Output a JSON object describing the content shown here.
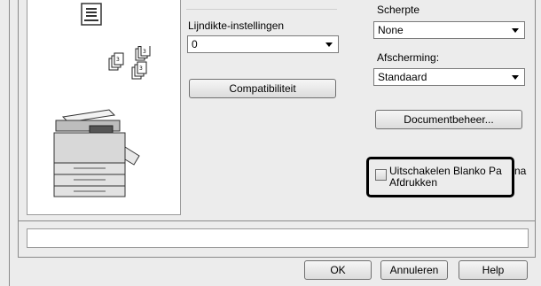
{
  "paper_thickness": {
    "label": "Lijndikte-instellingen",
    "value": "0"
  },
  "compat_button": {
    "label": "Compatibiliteit"
  },
  "sharpness": {
    "label": "Scherpte",
    "value": "None"
  },
  "smoothing": {
    "label": "Afscherming:",
    "value": "Standaard"
  },
  "doc_mgmt_button": {
    "label": "Documentbeheer..."
  },
  "blank_pages_checkbox": {
    "label_line1": "Uitschakelen Blanko Pa",
    "label_suffix": "na",
    "label_line2": "Afdrukken",
    "checked": false
  },
  "footer": {
    "ok": "OK",
    "cancel": "Annuleren",
    "help": "Help"
  },
  "colors": {
    "highlight_border": "#000000",
    "background": "#ececec"
  }
}
